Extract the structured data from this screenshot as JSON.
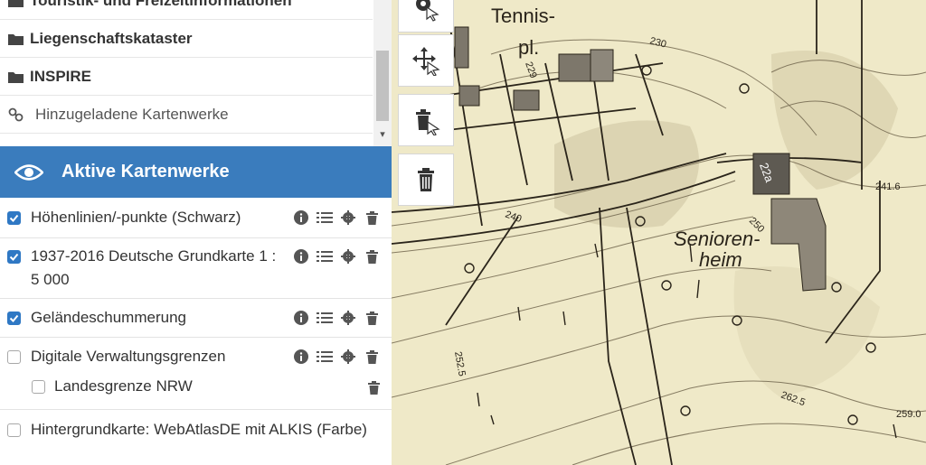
{
  "catalog": {
    "items": [
      {
        "label": "Touristik- und Freizeitinformationen",
        "icon": "folder-icon"
      },
      {
        "label": "Liegenschaftskataster",
        "icon": "folder-icon"
      },
      {
        "label": "INSPIRE",
        "icon": "folder-icon"
      },
      {
        "label": "Hinzugeladene Kartenwerke",
        "icon": "link-icon"
      }
    ]
  },
  "active_panel": {
    "title": "Aktive Kartenwerke",
    "icon": "eye-icon",
    "layers": [
      {
        "label": "Höhenlinien/-punkte (Schwarz)",
        "checked": true
      },
      {
        "label_line1": "1937-2016 Deutsche Grundkarte 1 :",
        "label_line2": "5 000",
        "checked": true
      },
      {
        "label": "Geländeschummerung",
        "checked": true
      },
      {
        "label": "Digitale Verwaltungsgrenzen",
        "checked": false
      },
      {
        "label": "Landesgrenze NRW",
        "checked": false
      },
      {
        "label": "Hintergrundkarte: WebAtlasDE mit ALKIS (Farbe)",
        "checked": false
      }
    ]
  },
  "map": {
    "labels": {
      "tennis1": "Tennis-",
      "tennis2": "pl.",
      "senioren1": "Senioren-",
      "senioren2": "heim",
      "house": "22a",
      "c230": "230",
      "c229": "229",
      "c240": "240",
      "c250": "250",
      "c252": "252.5",
      "c262": "262.5",
      "h241": "241.6",
      "h259": "259.0"
    }
  }
}
